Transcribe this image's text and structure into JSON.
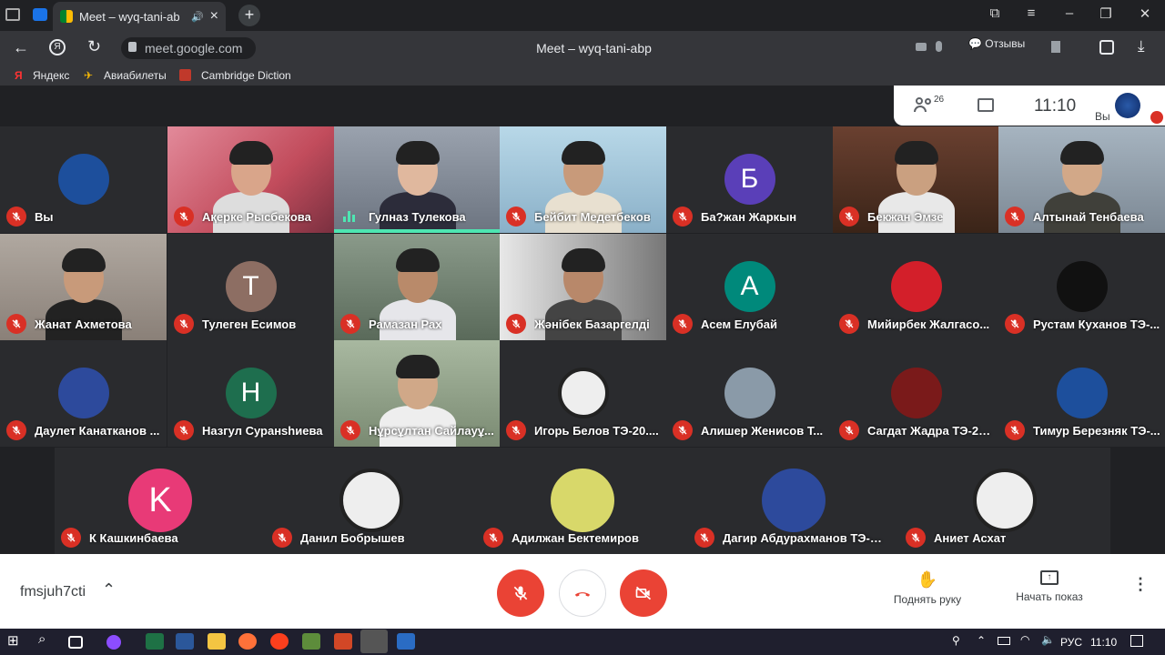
{
  "browser": {
    "tab_title": "Meet – wyq-tani-ab",
    "url": "meet.google.com",
    "page_title": "Meet – wyq-tani-abp",
    "feedback_label": "Отзывы",
    "bookmarks": [
      "Яндекс",
      "Авиабилеты",
      "Cambridge Diction"
    ]
  },
  "meet_info": {
    "participant_count": "26",
    "time": "11:10",
    "self_label": "Вы"
  },
  "participants": [
    {
      "name": "Вы"
    },
    {
      "name": "Ақерке Рысбекова"
    },
    {
      "name": "Гулназ Тулекова"
    },
    {
      "name": "Бейбит Медетбеков"
    },
    {
      "name": "Ба?жан Жаркын",
      "initial": "Б"
    },
    {
      "name": "Бекжан Эмзе"
    },
    {
      "name": "Алтынай Тенбаева"
    },
    {
      "name": "Жанат Ахметова"
    },
    {
      "name": "Тулеген Есимов",
      "initial": "Т"
    },
    {
      "name": "Рамазан Рах"
    },
    {
      "name": "Жәнібек Базаргелді"
    },
    {
      "name": "Асем Елубай",
      "initial": "А"
    },
    {
      "name": "Мийирбек Жалгасо..."
    },
    {
      "name": "Рустам Куханов ТЭ-..."
    },
    {
      "name": "Даулет Канатканов ..."
    },
    {
      "name": "Назгул Суранshиева",
      "initial": "Н"
    },
    {
      "name": "Нұрсұлтан Сайлауұ..."
    },
    {
      "name": "Игорь Белов ТЭ-20...."
    },
    {
      "name": "Алишер Женисов Т..."
    },
    {
      "name": "Сагдат Жадра ТЭ-20..."
    },
    {
      "name": "Тимур Березняк ТЭ-..."
    },
    {
      "name": "К Кашкинбаева",
      "initial": "K"
    },
    {
      "name": "Данил Бобрышев"
    },
    {
      "name": "Адилжан Бектемиров"
    },
    {
      "name": "Дагир Абдурахманов ТЭ-20-..."
    },
    {
      "name": "Аниет Асхат"
    }
  ],
  "bottom_bar": {
    "meeting_code": "fmsjuh7cti",
    "raise_hand": "Поднять руку",
    "present": "Начать показ"
  },
  "taskbar": {
    "lang": "РУС",
    "time": "11:10"
  },
  "colors": {
    "mute_red": "#d93025",
    "speaking_green": "#4ee6b2"
  }
}
